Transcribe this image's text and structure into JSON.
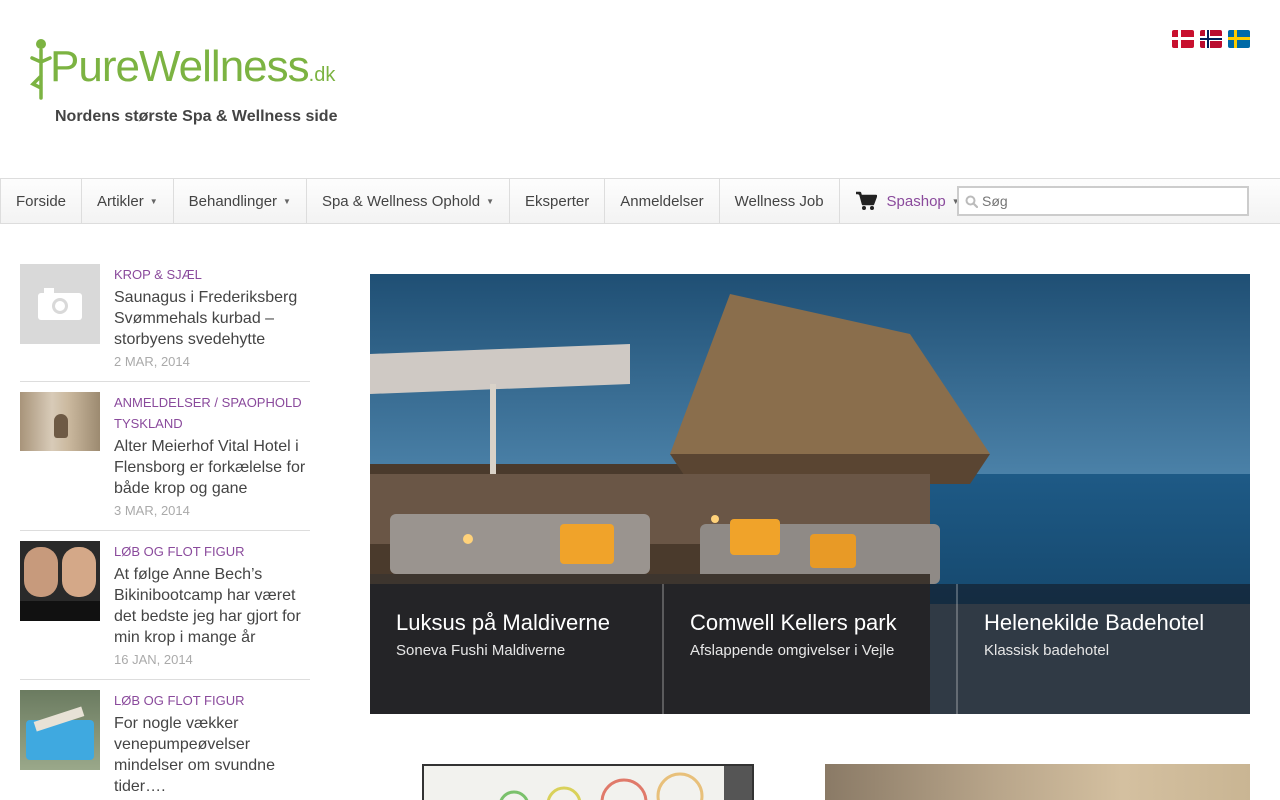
{
  "header": {
    "logo_main": "PureWellness",
    "logo_tld": ".dk",
    "tagline": "Nordens største Spa & Wellness side"
  },
  "languages": [
    {
      "name": "dk-flag-icon",
      "color": "#c8102e"
    },
    {
      "name": "no-flag-icon",
      "color": "#ba0c2f"
    },
    {
      "name": "se-flag-icon",
      "color": "#006aa7"
    }
  ],
  "nav": {
    "items": [
      {
        "label": "Forside",
        "has_dropdown": false
      },
      {
        "label": "Artikler",
        "has_dropdown": true
      },
      {
        "label": "Behandlinger",
        "has_dropdown": true
      },
      {
        "label": "Spa & Wellness Ophold",
        "has_dropdown": true
      },
      {
        "label": "Eksperter",
        "has_dropdown": false
      },
      {
        "label": "Anmeldelser",
        "has_dropdown": false
      },
      {
        "label": "Wellness Job",
        "has_dropdown": false
      }
    ],
    "shop_label": "Spashop",
    "search_placeholder": "Søg"
  },
  "posts": [
    {
      "category": "Krop & Sjæl",
      "title": "Saunagus i Frederiksberg Svømmehals kurbad – storbyens svedehytte",
      "date": "2 Mar, 2014"
    },
    {
      "category": "Anmeldelser / Spaophold Tyskland",
      "title": "Alter Meierhof Vital Hotel i Flensborg er forkælelse for både krop og gane",
      "date": "3 Mar, 2014"
    },
    {
      "category": "Løb og flot figur",
      "title": "At følge Anne Bech’s Bikinibootcamp har været det bedste jeg har gjort for min krop i mange år",
      "date": "16 Jan, 2014"
    },
    {
      "category": "Løb og flot figur",
      "title": "For nogle vækker venepumpeøvelser mindelser om svundne tider….",
      "date": ""
    }
  ],
  "slider": [
    {
      "title": "Luksus på Maldiverne",
      "subtitle": "Soneva Fushi Maldiverne"
    },
    {
      "title": "Comwell Kellers park",
      "subtitle": "Afslappende omgivelser i Vejle"
    },
    {
      "title": "Helenekilde Badehotel",
      "subtitle": "Klassisk badehotel"
    }
  ],
  "colors": {
    "accent": "#8a4a9c",
    "logo_green": "#7cb342"
  }
}
